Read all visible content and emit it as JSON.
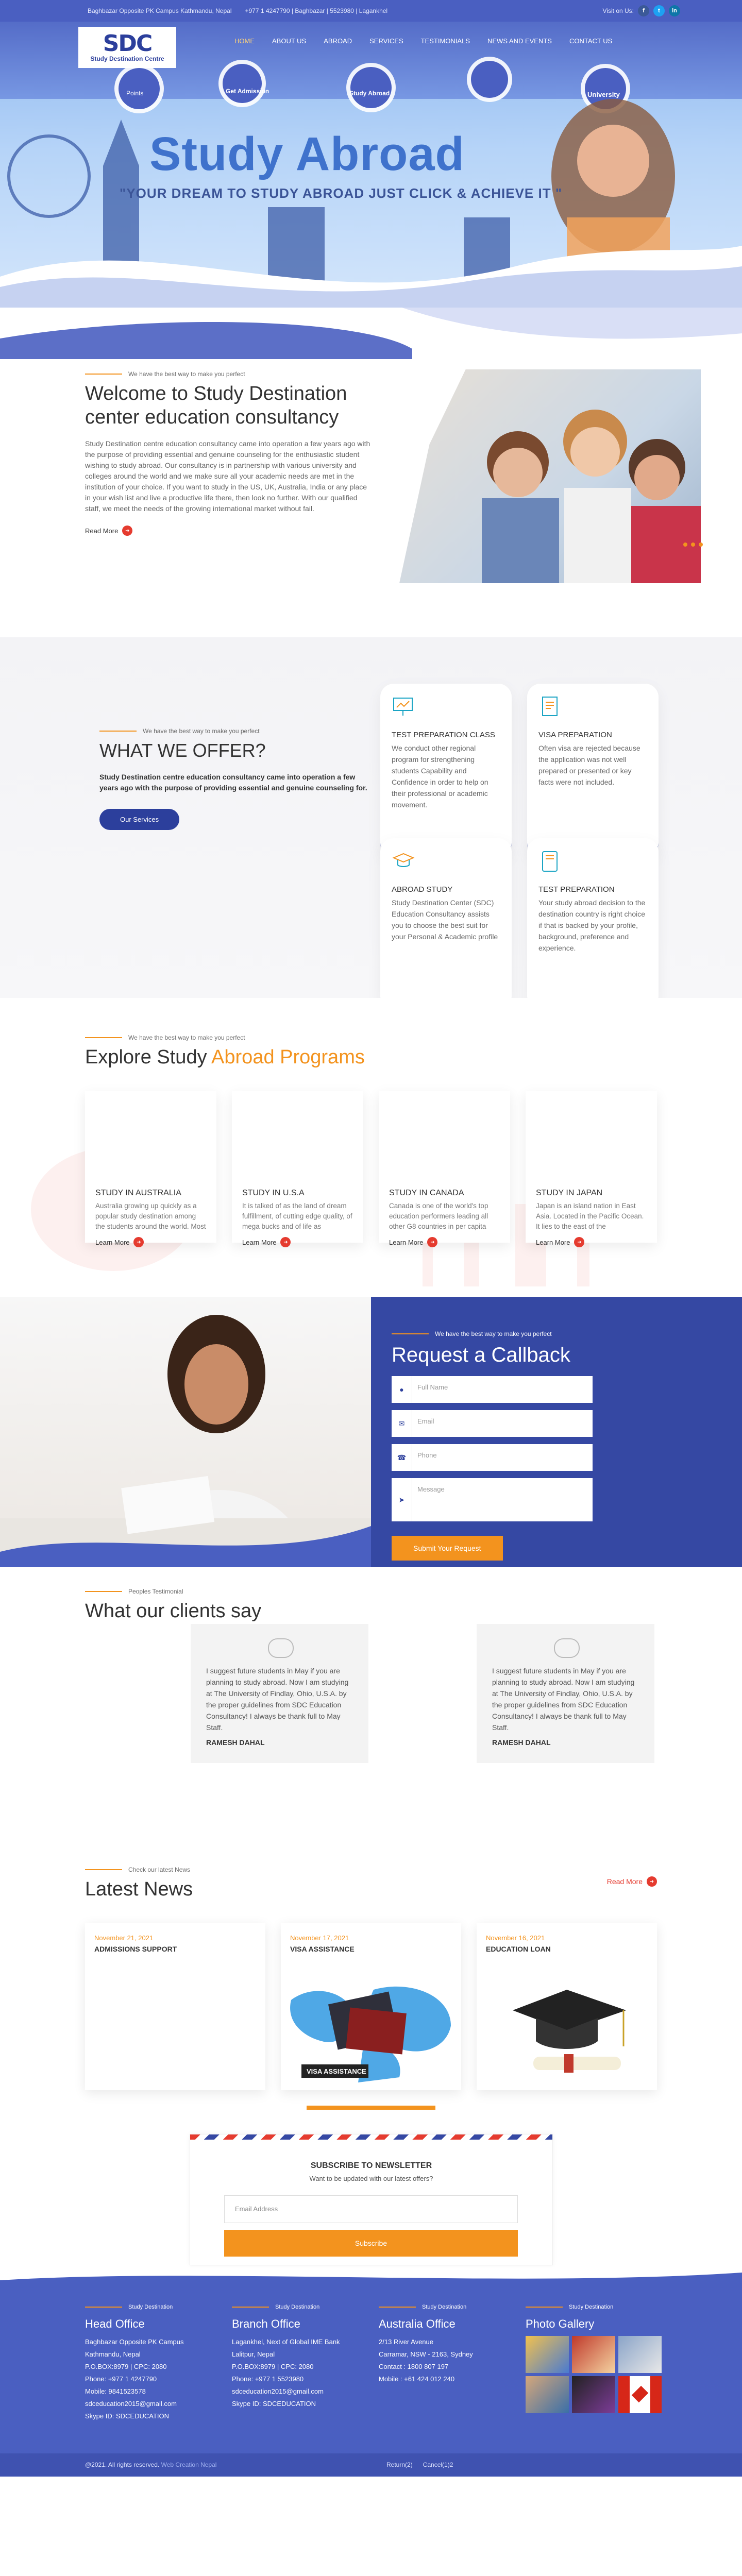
{
  "topbar": {
    "address": "Baghbazar Opposite PK Campus Kathmandu, Nepal",
    "phone": "+977 1 4247790 | Baghbazar | 5523980 | Lagankhel",
    "visit_label": "Visit on Us:",
    "social": [
      "f",
      "t",
      "in"
    ]
  },
  "logo": {
    "letters": "SDC",
    "subtitle": "Study Destination Centre"
  },
  "nav": {
    "items": [
      "HOME",
      "ABOUT US",
      "ABROAD",
      "SERVICES",
      "TESTIMONIALS",
      "NEWS AND EVENTS",
      "CONTACT US"
    ],
    "active_index": 0
  },
  "hero": {
    "title": "Study Abroad",
    "subtitle": "\"YOUR DREAM TO STUDY ABROAD JUST CLICK & ACHIEVE IT \"",
    "bubbles": [
      "Points",
      "Get Admission",
      "Study Abroad",
      "",
      "University"
    ]
  },
  "welcome": {
    "kicker": "We have the best way to make you perfect",
    "title": "Welcome to Study Destination center education consultancy",
    "body": "Study Destination centre education consultancy came into operation a few years ago with the purpose of providing essential and genuine counseling for the enthusiastic student wishing to study abroad. Our consultancy is in partnership with various university and colleges around the world and we make sure all your academic needs are met in the institution of your choice. If you want to study in the US, UK, Australia, India or any place in your wish list and live a productive life there, then look no further. With our qualified staff, we meet the needs of the growing international market without fail.",
    "read_more": "Read More"
  },
  "offer": {
    "kicker": "We have the best way to make you perfect",
    "title": "WHAT WE OFFER?",
    "body": "Study Destination centre education consultancy came into operation a few years ago with the purpose of providing essential and genuine counseling for.",
    "button": "Our Services",
    "cards": [
      {
        "title": "TEST PREPARATION CLASS",
        "text": "We conduct other regional program for strengthening students Capability and Confidence in order to help on their professional or academic movement."
      },
      {
        "title": "VISA PREPARATION",
        "text": "Often visa are rejected because the application was not well prepared or presented or key facts were not included."
      },
      {
        "title": "ABROAD STUDY",
        "text": "Study Destination Center (SDC) Education Consultancy assists you to choose the best suit for your Personal & Academic profile"
      },
      {
        "title": "TEST PREPARATION",
        "text": "Your study abroad decision to the destination country is right choice if that is backed by your profile, background, preference and experience."
      }
    ]
  },
  "programs": {
    "kicker": "We have the best way to make you perfect",
    "title_plain": "Explore Study ",
    "title_accent": "Abroad Programs",
    "cards": [
      {
        "title": "STUDY IN AUSTRALIA",
        "text": "Australia growing up quickly as a popular study destination among the students around the world. Most of the students go",
        "link": "Learn More"
      },
      {
        "title": "STUDY IN U.S.A",
        "text": "It is talked of as the land of dream fulfillment, of cutting edge quality, of mega bucks and of life as",
        "link": "Learn More"
      },
      {
        "title": "STUDY IN CANADA",
        "text": "Canada is one of the world's top education performers leading all other G8 countries in per capita spending on education.",
        "link": "Learn More"
      },
      {
        "title": "STUDY IN JAPAN",
        "text": "Japan is an island nation in East Asia. Located in the Pacific Ocean. It lies to the east of the",
        "link": "Learn More"
      }
    ]
  },
  "callback": {
    "kicker": "We have the best way to make you perfect",
    "title": "Request a Callback",
    "fields": [
      {
        "icon": "user-icon",
        "placeholder": "Full Name"
      },
      {
        "icon": "mail-icon",
        "placeholder": "Email"
      },
      {
        "icon": "phone-icon",
        "placeholder": "Phone"
      },
      {
        "icon": "send-icon",
        "placeholder": "Message"
      }
    ],
    "submit": "Submit Your Request"
  },
  "testimonials": {
    "kicker": "Peoples Testimonial",
    "title": "What our clients say",
    "items": [
      {
        "text": "I suggest future students in May if you are planning to study abroad. Now I am studying at The University of Findlay, Ohio, U.S.A. by the proper guidelines from SDC Education Consultancy! I always be thank full to May Staff.",
        "name": "RAMESH DAHAL"
      },
      {
        "text": "I suggest future students in May if you are planning to study abroad. Now I am studying at The University of Findlay, Ohio, U.S.A. by the proper guidelines from SDC Education Consultancy! I always be thank full to May Staff.",
        "name": "RAMESH DAHAL"
      }
    ]
  },
  "news": {
    "kicker": "Check our latest News",
    "title": "Latest News",
    "read_more": "Read More",
    "items": [
      {
        "date": "November 21, 2021",
        "title": "ADMISSIONS SUPPORT",
        "tag": ""
      },
      {
        "date": "November 17, 2021",
        "title": "VISA ASSISTANCE",
        "tag": "VISA ASSISTANCE"
      },
      {
        "date": "November 16, 2021",
        "title": "EDUCATION LOAN",
        "tag": ""
      }
    ]
  },
  "newsletter": {
    "title": "SUBSCRIBE TO NEWSLETTER",
    "subtitle": "Want to be updated with our latest offers?",
    "placeholder": "Email Address",
    "button": "Subscribe"
  },
  "footer": {
    "kicker": "Study Destination",
    "cols": [
      {
        "title": "Head Office",
        "lines": [
          "Baghbazar Opposite PK Campus",
          "Kathmandu, Nepal",
          "P.O.BOX:8979 | CPC: 2080",
          "Phone: +977 1 4247790",
          "Mobile: 9841523578",
          "sdceducation2015@gmail.com",
          "Skype ID: SDCEDUCATION"
        ]
      },
      {
        "title": "Branch Office",
        "lines": [
          "Lagankhel, Next of Global IME Bank",
          "Lalitpur, Nepal",
          "P.O.BOX:8979 | CPC: 2080",
          "Phone: +977 1 5523980",
          "sdceducation2015@gmail.com",
          "Skype ID: SDCEDUCATION"
        ]
      },
      {
        "title": "Australia Office",
        "lines": [
          "2/13 River Avenue",
          "Carramar, NSW - 2163, Sydney",
          "Contact : 1800 807 197",
          "Mobile : +61 424 012 240"
        ]
      }
    ],
    "gallery_title": "Photo Gallery",
    "copyright": "@2021. All rights reserved.",
    "credit": "Web Creation Nepal",
    "links": [
      "Return(2)",
      "Cancel(1)2"
    ]
  },
  "colors": {
    "primary": "#4a5fc1",
    "dark": "#2c3f9c",
    "accent": "#f3931e",
    "red": "#e53b2f"
  }
}
